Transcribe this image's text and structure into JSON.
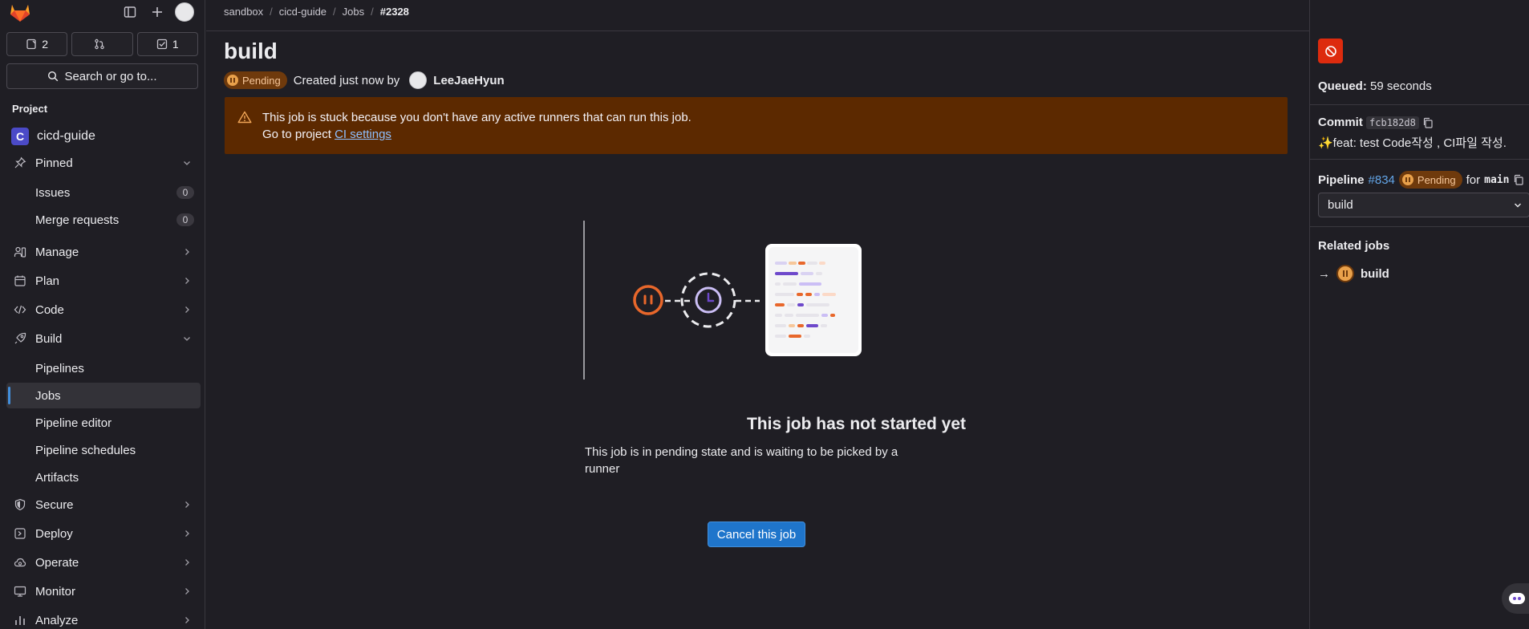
{
  "sidebar": {
    "counters": [
      {
        "icon": "issues-icon",
        "count": "2"
      },
      {
        "icon": "merge-request-icon",
        "count": ""
      },
      {
        "icon": "todo-icon",
        "count": "1"
      }
    ],
    "search_label": "Search or go to...",
    "section_label": "Project",
    "project": {
      "initial": "C",
      "name": "cicd-guide"
    },
    "items": [
      {
        "label": "Pinned",
        "icon": "pin-icon"
      },
      {
        "label": "Issues",
        "count": "0"
      },
      {
        "label": "Merge requests",
        "count": "0"
      },
      {
        "label": "Manage",
        "icon": "users-icon"
      },
      {
        "label": "Plan",
        "icon": "calendar-icon"
      },
      {
        "label": "Code",
        "icon": "code-icon"
      },
      {
        "label": "Build",
        "icon": "rocket-icon"
      },
      {
        "label": "Pipelines"
      },
      {
        "label": "Jobs"
      },
      {
        "label": "Pipeline editor"
      },
      {
        "label": "Pipeline schedules"
      },
      {
        "label": "Artifacts"
      },
      {
        "label": "Secure",
        "icon": "shield-icon"
      },
      {
        "label": "Deploy",
        "icon": "deploy-icon"
      },
      {
        "label": "Operate",
        "icon": "cloud-icon"
      },
      {
        "label": "Monitor",
        "icon": "monitor-icon"
      },
      {
        "label": "Analyze",
        "icon": "chart-icon"
      }
    ]
  },
  "breadcrumb": [
    "sandbox",
    "cicd-guide",
    "Jobs",
    "#2328"
  ],
  "job": {
    "title": "build",
    "status": "Pending",
    "created_text": "Created just now by",
    "author": "LeeJaeHyun"
  },
  "alert": {
    "line1": "This job is stuck because you don't have any active runners that can run this job.",
    "line2_prefix": "Go to project",
    "line2_link": "CI settings"
  },
  "empty_state": {
    "title": "This job has not started yet",
    "description": "This job is in pending state and is waiting to be picked by a runner",
    "cancel_label": "Cancel this job"
  },
  "right_panel": {
    "queued_label": "Queued:",
    "queued_value": "59 seconds",
    "commit_label": "Commit",
    "commit_sha": "fcb182d8",
    "commit_message": "✨feat: test Code작성 , CI파일 작성.",
    "pipeline_label": "Pipeline",
    "pipeline_id": "#834",
    "pipeline_status": "Pending",
    "pipeline_for": "for",
    "pipeline_ref": "main",
    "stage_selected": "build",
    "related_title": "Related jobs",
    "related_job": "build"
  },
  "colors": {
    "alert_bg": "#5c2900",
    "pending": "#e9a14b",
    "primary": "#1f75cb",
    "danger": "#dd2b0e"
  }
}
